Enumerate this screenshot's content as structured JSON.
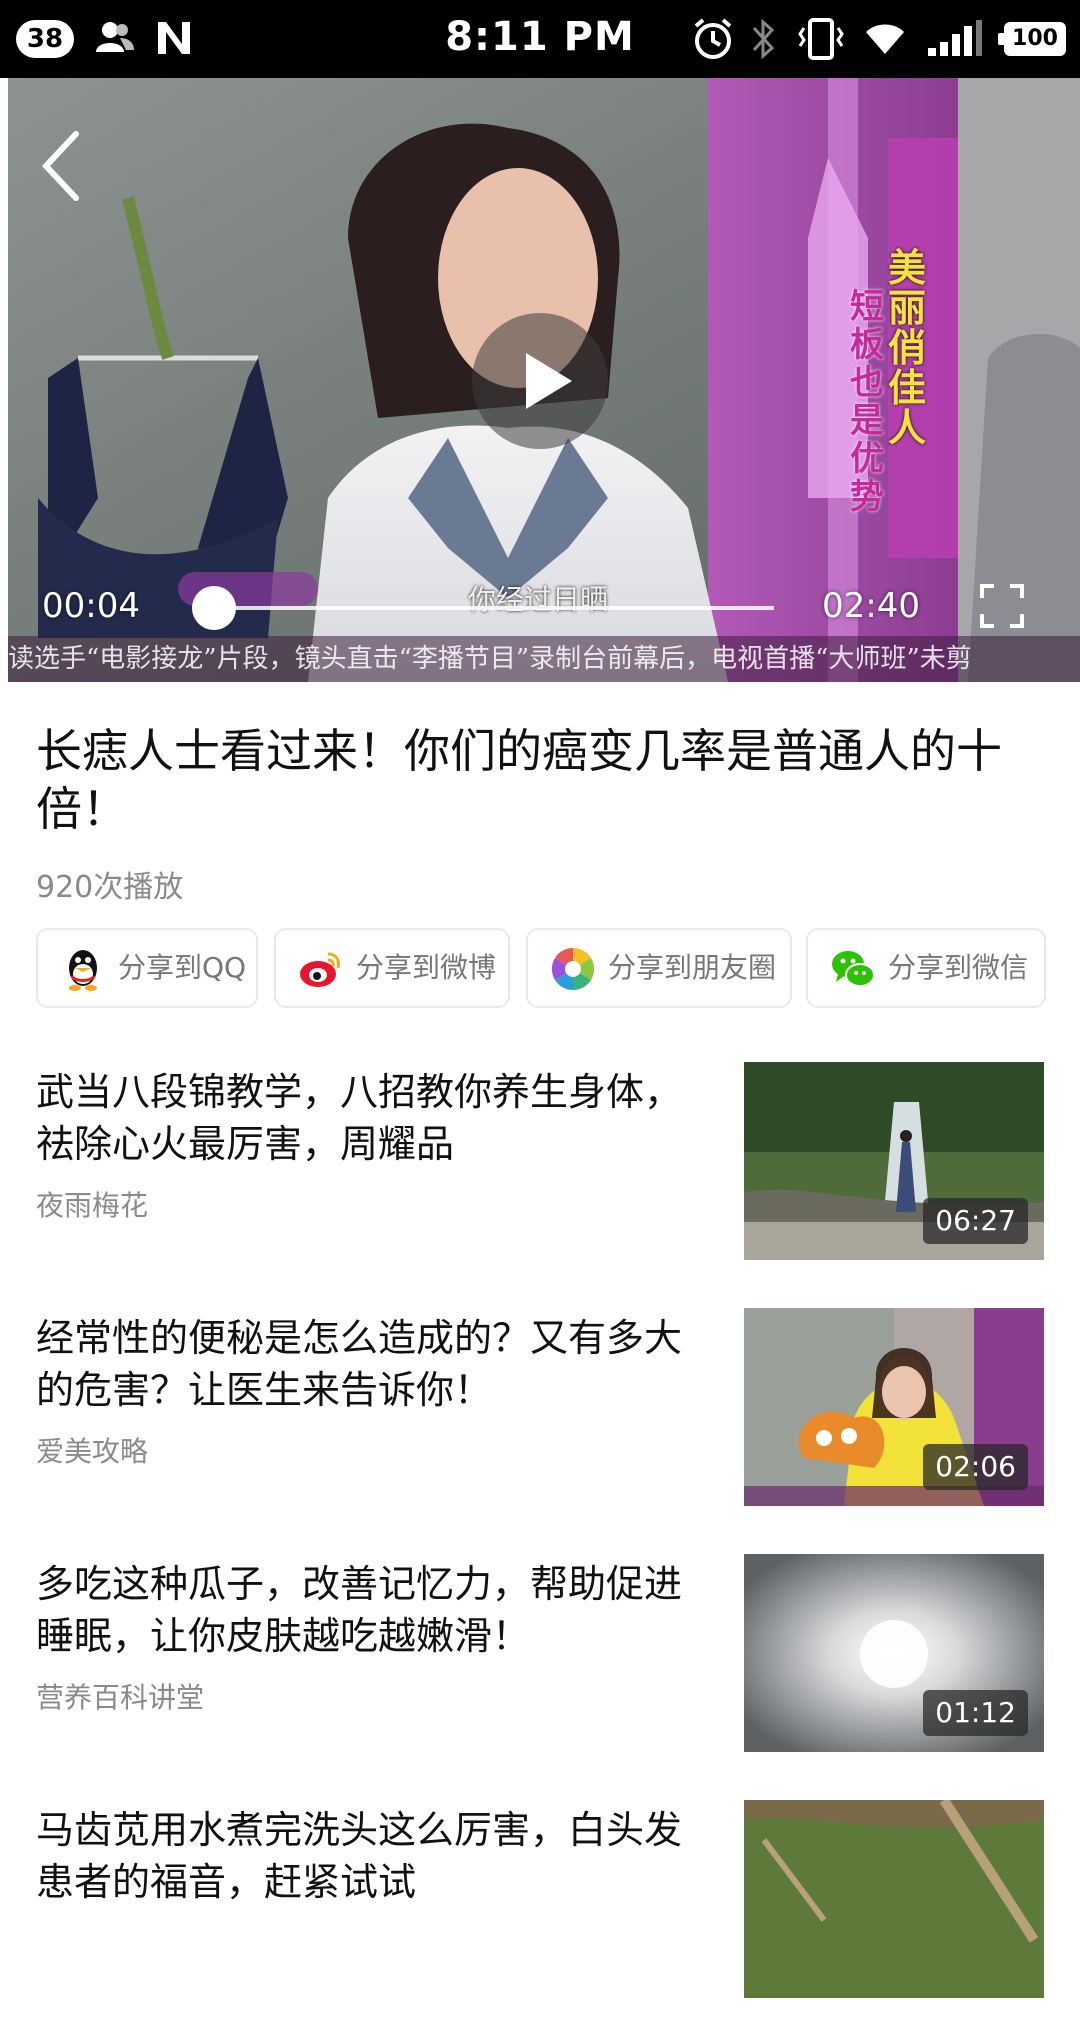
{
  "status_bar": {
    "notification_count": "38",
    "time": "8:11 PM",
    "battery": "100",
    "icons": [
      "contacts-icon",
      "n-app-icon",
      "alarm-icon",
      "bluetooth-icon",
      "vibrate-icon",
      "wifi-icon",
      "signal-icon"
    ]
  },
  "player": {
    "current_time": "00:04",
    "total_time": "02:40",
    "progress": 0.025,
    "overlay_vertical_1": "美丽俏佳人",
    "overlay_vertical_2": "短板也是优势",
    "subtitle": "你经过日晒",
    "ticker": "读选手“电影接龙”片段，镜头直击“李播节目”录制台前幕后，电视首播“大师班”未剪"
  },
  "video": {
    "title": "长痣人士看过来！你们的癌变几率是普通人的十倍！",
    "play_count": "920次播放"
  },
  "share": [
    {
      "label": "分享到QQ",
      "icon": "qq-icon"
    },
    {
      "label": "分享到微博",
      "icon": "weibo-icon"
    },
    {
      "label": "分享到朋友圈",
      "icon": "moments-icon"
    },
    {
      "label": "分享到微信",
      "icon": "wechat-icon"
    }
  ],
  "related": [
    {
      "title": "武当八段锦教学，八招教你养生身体，祛除心火最厉害，周耀品",
      "author": "夜雨梅花",
      "duration": "06:27"
    },
    {
      "title": "经常性的便秘是怎么造成的？又有多大的危害？让医生来告诉你！",
      "author": "爱美攻略",
      "duration": "02:06"
    },
    {
      "title": "多吃这种瓜子，改善记忆力，帮助促进睡眠，让你皮肤越吃越嫩滑！",
      "author": "营养百科讲堂",
      "duration": "01:12"
    },
    {
      "title": "马齿苋用水煮完洗头这么厉害，白头发患者的福音，赶紧试试",
      "author": "",
      "duration": ""
    }
  ],
  "colors": {
    "accent_text": "#111111",
    "secondary_text": "#8a8a8a",
    "share_border": "#e9e9e9"
  }
}
